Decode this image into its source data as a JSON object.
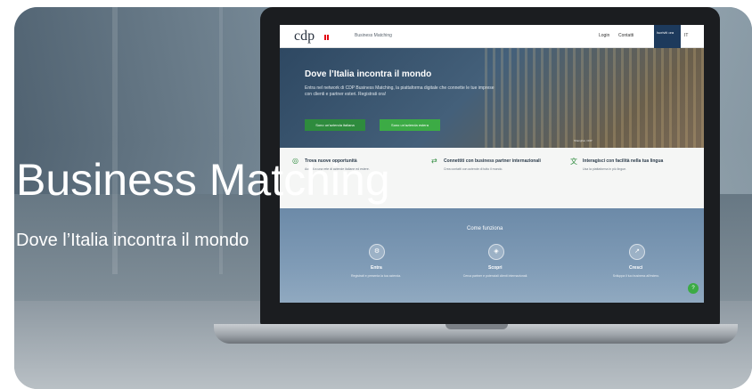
{
  "overlay": {
    "title": "Business Matching",
    "subtitle": "Dove l’Italia incontra il mondo"
  },
  "site": {
    "logo_text": "cdp",
    "site_name": "Business Matching",
    "nav": {
      "login": "Login",
      "contacts": "Contatti",
      "cta": "Iscriviti ora",
      "lang": "IT"
    },
    "hero": {
      "title": "Dove l’Italia incontra il mondo",
      "text": "Entra nel network di CDP Business Matching, la piattaforma digitale che connette le tue imprese con clienti e partner esteri. Registrati ora!",
      "btn_primary": "Sono un'azienda italiana",
      "btn_secondary": "Sono un'azienda estera",
      "caption": "Shanghai, CDP"
    },
    "features": [
      {
        "title": "Trova nuove opportunità",
        "text": "Accedi a una rete di aziende italiane ed estere."
      },
      {
        "title": "Connettiti con business partner internazionali",
        "text": "Crea contatti con aziende di tutto il mondo."
      },
      {
        "title": "Interagisci con facilità nella tua lingua",
        "text": "Usa la piattaforma in più lingue."
      }
    ],
    "how": {
      "title": "Come funziona",
      "steps": [
        {
          "label": "Entra",
          "text": "Registrati e presenta la tua azienda."
        },
        {
          "label": "Scopri",
          "text": "Cerca partner e potenziali clienti internazionali."
        },
        {
          "label": "Cresci",
          "text": "Sviluppa il tuo business all'estero."
        }
      ]
    },
    "help_icon": "help-icon"
  },
  "colors": {
    "brand_green": "#3cab45",
    "brand_navy": "#1d3a5c"
  }
}
